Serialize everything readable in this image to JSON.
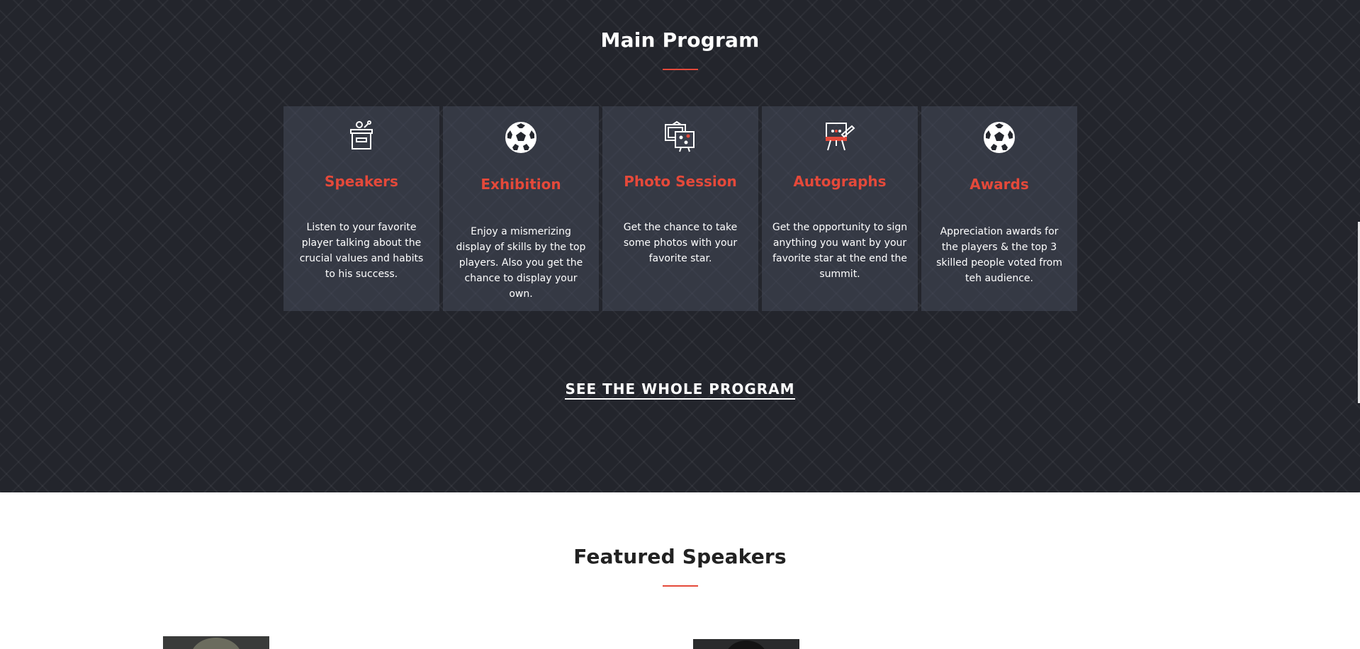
{
  "program": {
    "title": "Main Program",
    "accent_color": "#e5493a",
    "cards": [
      {
        "icon": "podium-speaker-icon",
        "title": "Speakers",
        "description": "Listen to your favorite player talking about the crucial values and habits to his success."
      },
      {
        "icon": "soccer-ball-icon",
        "title": "Exhibition",
        "description": "Enjoy a mismerizing display of skills by the top players. Also you get the chance to display your own."
      },
      {
        "icon": "photo-frames-icon",
        "title": "Photo Session",
        "description": "Get the chance to take some photos with your favorite star."
      },
      {
        "icon": "easel-pen-icon",
        "title": "Autographs",
        "description": "Get the opportunity to sign anything you want by your favorite star at the end the summit."
      },
      {
        "icon": "soccer-ball-icon",
        "title": "Awards",
        "description": "Appreciation awards for the players & the top 3 skilled people voted from teh audience."
      }
    ],
    "cta_label": "SEE THE WHOLE PROGRAM"
  },
  "speakers": {
    "title": "Featured Speakers"
  }
}
